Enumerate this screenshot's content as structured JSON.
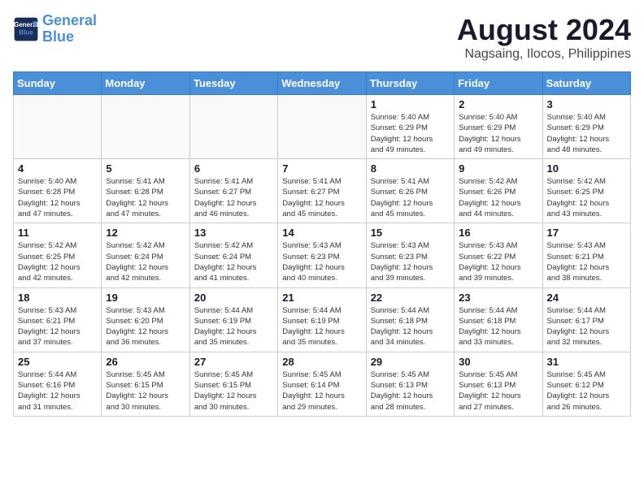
{
  "logo": {
    "line1": "General",
    "line2": "Blue"
  },
  "title": "August 2024",
  "subtitle": "Nagsaing, Ilocos, Philippines",
  "weekdays": [
    "Sunday",
    "Monday",
    "Tuesday",
    "Wednesday",
    "Thursday",
    "Friday",
    "Saturday"
  ],
  "weeks": [
    [
      {
        "day": "",
        "info": ""
      },
      {
        "day": "",
        "info": ""
      },
      {
        "day": "",
        "info": ""
      },
      {
        "day": "",
        "info": ""
      },
      {
        "day": "1",
        "info": "Sunrise: 5:40 AM\nSunset: 6:29 PM\nDaylight: 12 hours\nand 49 minutes."
      },
      {
        "day": "2",
        "info": "Sunrise: 5:40 AM\nSunset: 6:29 PM\nDaylight: 12 hours\nand 49 minutes."
      },
      {
        "day": "3",
        "info": "Sunrise: 5:40 AM\nSunset: 6:29 PM\nDaylight: 12 hours\nand 48 minutes."
      }
    ],
    [
      {
        "day": "4",
        "info": "Sunrise: 5:40 AM\nSunset: 6:28 PM\nDaylight: 12 hours\nand 47 minutes."
      },
      {
        "day": "5",
        "info": "Sunrise: 5:41 AM\nSunset: 6:28 PM\nDaylight: 12 hours\nand 47 minutes."
      },
      {
        "day": "6",
        "info": "Sunrise: 5:41 AM\nSunset: 6:27 PM\nDaylight: 12 hours\nand 46 minutes."
      },
      {
        "day": "7",
        "info": "Sunrise: 5:41 AM\nSunset: 6:27 PM\nDaylight: 12 hours\nand 45 minutes."
      },
      {
        "day": "8",
        "info": "Sunrise: 5:41 AM\nSunset: 6:26 PM\nDaylight: 12 hours\nand 45 minutes."
      },
      {
        "day": "9",
        "info": "Sunrise: 5:42 AM\nSunset: 6:26 PM\nDaylight: 12 hours\nand 44 minutes."
      },
      {
        "day": "10",
        "info": "Sunrise: 5:42 AM\nSunset: 6:25 PM\nDaylight: 12 hours\nand 43 minutes."
      }
    ],
    [
      {
        "day": "11",
        "info": "Sunrise: 5:42 AM\nSunset: 6:25 PM\nDaylight: 12 hours\nand 42 minutes."
      },
      {
        "day": "12",
        "info": "Sunrise: 5:42 AM\nSunset: 6:24 PM\nDaylight: 12 hours\nand 42 minutes."
      },
      {
        "day": "13",
        "info": "Sunrise: 5:42 AM\nSunset: 6:24 PM\nDaylight: 12 hours\nand 41 minutes."
      },
      {
        "day": "14",
        "info": "Sunrise: 5:43 AM\nSunset: 6:23 PM\nDaylight: 12 hours\nand 40 minutes."
      },
      {
        "day": "15",
        "info": "Sunrise: 5:43 AM\nSunset: 6:23 PM\nDaylight: 12 hours\nand 39 minutes."
      },
      {
        "day": "16",
        "info": "Sunrise: 5:43 AM\nSunset: 6:22 PM\nDaylight: 12 hours\nand 39 minutes."
      },
      {
        "day": "17",
        "info": "Sunrise: 5:43 AM\nSunset: 6:21 PM\nDaylight: 12 hours\nand 38 minutes."
      }
    ],
    [
      {
        "day": "18",
        "info": "Sunrise: 5:43 AM\nSunset: 6:21 PM\nDaylight: 12 hours\nand 37 minutes."
      },
      {
        "day": "19",
        "info": "Sunrise: 5:43 AM\nSunset: 6:20 PM\nDaylight: 12 hours\nand 36 minutes."
      },
      {
        "day": "20",
        "info": "Sunrise: 5:44 AM\nSunset: 6:19 PM\nDaylight: 12 hours\nand 35 minutes."
      },
      {
        "day": "21",
        "info": "Sunrise: 5:44 AM\nSunset: 6:19 PM\nDaylight: 12 hours\nand 35 minutes."
      },
      {
        "day": "22",
        "info": "Sunrise: 5:44 AM\nSunset: 6:18 PM\nDaylight: 12 hours\nand 34 minutes."
      },
      {
        "day": "23",
        "info": "Sunrise: 5:44 AM\nSunset: 6:18 PM\nDaylight: 12 hours\nand 33 minutes."
      },
      {
        "day": "24",
        "info": "Sunrise: 5:44 AM\nSunset: 6:17 PM\nDaylight: 12 hours\nand 32 minutes."
      }
    ],
    [
      {
        "day": "25",
        "info": "Sunrise: 5:44 AM\nSunset: 6:16 PM\nDaylight: 12 hours\nand 31 minutes."
      },
      {
        "day": "26",
        "info": "Sunrise: 5:45 AM\nSunset: 6:15 PM\nDaylight: 12 hours\nand 30 minutes."
      },
      {
        "day": "27",
        "info": "Sunrise: 5:45 AM\nSunset: 6:15 PM\nDaylight: 12 hours\nand 30 minutes."
      },
      {
        "day": "28",
        "info": "Sunrise: 5:45 AM\nSunset: 6:14 PM\nDaylight: 12 hours\nand 29 minutes."
      },
      {
        "day": "29",
        "info": "Sunrise: 5:45 AM\nSunset: 6:13 PM\nDaylight: 12 hours\nand 28 minutes."
      },
      {
        "day": "30",
        "info": "Sunrise: 5:45 AM\nSunset: 6:13 PM\nDaylight: 12 hours\nand 27 minutes."
      },
      {
        "day": "31",
        "info": "Sunrise: 5:45 AM\nSunset: 6:12 PM\nDaylight: 12 hours\nand 26 minutes."
      }
    ]
  ]
}
